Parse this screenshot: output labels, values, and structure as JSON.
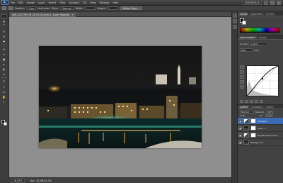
{
  "app": {
    "logo": "Ps"
  },
  "menu": {
    "items": [
      "File",
      "Edit",
      "Image",
      "Layer",
      "Select",
      "Filter",
      "Analysis",
      "3D",
      "View",
      "Window",
      "Help"
    ],
    "workspace": "ESSENTIALS",
    "window_buttons": [
      "–",
      "□",
      "×"
    ]
  },
  "options": {
    "feather_label": "Feather:",
    "feather_value": "0 px",
    "antialias_label": "Anti-alias",
    "style_label": "Style:",
    "style_value": "Normal",
    "width_label": "Width:",
    "height_label": "Height:",
    "refine_label": "Refine Edge..."
  },
  "document": {
    "tab_title": "IMG_3477.JPG @ 16.7% (Curves 1, Layer Mask/8)",
    "close": "×"
  },
  "status": {
    "zoom": "16.67%",
    "doc_size": "Doc: 34.3M/34.3M"
  },
  "tools": {
    "glyphs": [
      "⬚",
      "✥",
      "⌒",
      "✎",
      "⊡",
      "✚",
      "⊘",
      "✑",
      "▣",
      "⌀",
      "◐",
      "✒",
      "T",
      "↖",
      "▭",
      "✋",
      "⌕"
    ]
  },
  "panels": {
    "color_tabs": [
      "COLOR",
      "SWATCHES",
      "STYLES"
    ],
    "adj_tabs": [
      "ADJUSTMENTS",
      "MASKS"
    ],
    "adj_title": "Curves",
    "preset_label": "Custom",
    "channel_label": "RGB",
    "auto_label": "Auto",
    "layers_tabs": [
      "LAYERS",
      "CHANNELS",
      "PATHS"
    ],
    "blend_mode": "Normal",
    "opacity_label": "Opacity:",
    "opacity_value": "100%",
    "lock_label": "Lock:",
    "fill_label": "Fill:",
    "fill_value": "100%"
  },
  "layers": [
    {
      "name": "Curves 1",
      "type": "adjustment",
      "selected": true
    },
    {
      "name": "Layer 1",
      "type": "mask",
      "selected": false
    },
    {
      "name": "Brightness/Contra...",
      "type": "adjustment",
      "selected": false
    },
    {
      "name": "Background",
      "type": "photo",
      "selected": false
    }
  ]
}
